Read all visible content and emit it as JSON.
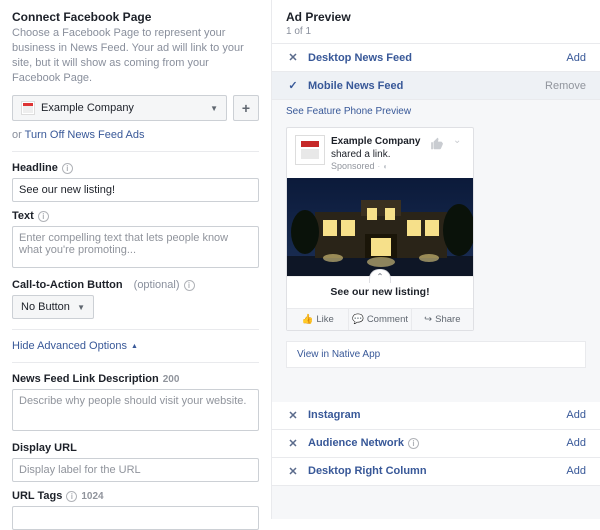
{
  "left": {
    "connect_title": "Connect Facebook Page",
    "connect_sub": "Choose a Facebook Page to represent your business in News Feed. Your ad will link to your site, but it will show as coming from your Facebook Page.",
    "selected_page": "Example Company",
    "or_text": "or ",
    "turn_off_link": "Turn Off News Feed Ads",
    "headline_label": "Headline",
    "headline_value": "See our new listing!",
    "text_label": "Text",
    "text_placeholder": "Enter compelling text that lets people know what you're promoting...",
    "cta_label": "Call-to-Action Button",
    "cta_optional": "(optional)",
    "cta_value": "No Button",
    "advanced_link": "Hide Advanced Options",
    "nfld_label": "News Feed Link Description",
    "nfld_counter": "200",
    "nfld_placeholder": "Describe why people should visit your website.",
    "display_url_label": "Display URL",
    "display_url_placeholder": "Display label for the URL",
    "url_tags_label": "URL Tags",
    "url_tags_counter": "1024"
  },
  "right": {
    "preview_title": "Ad Preview",
    "preview_count": "1 of 1",
    "desktop_news": "Desktop News Feed",
    "mobile_news": "Mobile News Feed",
    "add_label": "Add",
    "remove_label": "Remove",
    "feature_phone": "See Feature Phone Preview",
    "mock": {
      "name": "Example Company",
      "shared": " shared a link.",
      "sponsored": "Sponsored",
      "caption": "See our new listing!",
      "like": "Like",
      "comment": "Comment",
      "share": "Share"
    },
    "native_app": "View in Native App",
    "instagram": "Instagram",
    "audience_network": "Audience Network",
    "right_column": "Desktop Right Column"
  }
}
